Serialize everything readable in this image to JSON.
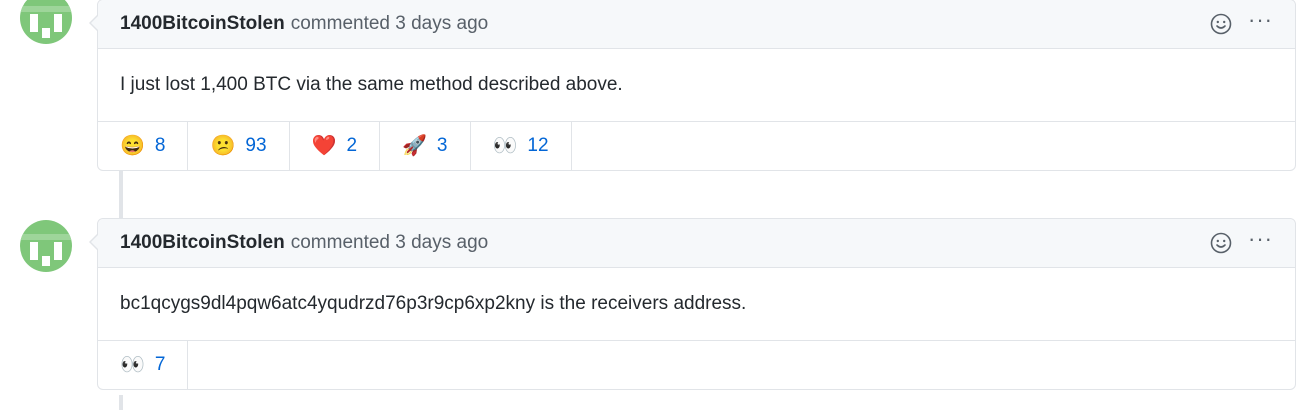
{
  "comments": [
    {
      "author": "1400BitcoinStolen",
      "meta": "commented 3 days ago",
      "body": "I just lost 1,400 BTC via the same method described above.",
      "more_label": "···",
      "reactions": [
        {
          "emoji": "😄",
          "count": "8",
          "icon": "grinning-face-icon"
        },
        {
          "emoji": "😕",
          "count": "93",
          "icon": "confused-face-icon"
        },
        {
          "emoji": "❤️",
          "count": "2",
          "icon": "heart-icon"
        },
        {
          "emoji": "🚀",
          "count": "3",
          "icon": "rocket-icon"
        },
        {
          "emoji": "👀",
          "count": "12",
          "icon": "eyes-icon"
        }
      ]
    },
    {
      "author": "1400BitcoinStolen",
      "meta": "commented 3 days ago",
      "body": "bc1qcygs9dl4pqw6atc4yqudrzd76p3r9cp6xp2kny is the receivers address.",
      "more_label": "···",
      "reactions": [
        {
          "emoji": "👀",
          "count": "7",
          "icon": "eyes-icon"
        }
      ]
    }
  ],
  "colors": {
    "avatar_bg": "#7fc77a",
    "link": "#0366d6",
    "header_bg": "#f6f8fa",
    "border": "#e1e4e8"
  }
}
